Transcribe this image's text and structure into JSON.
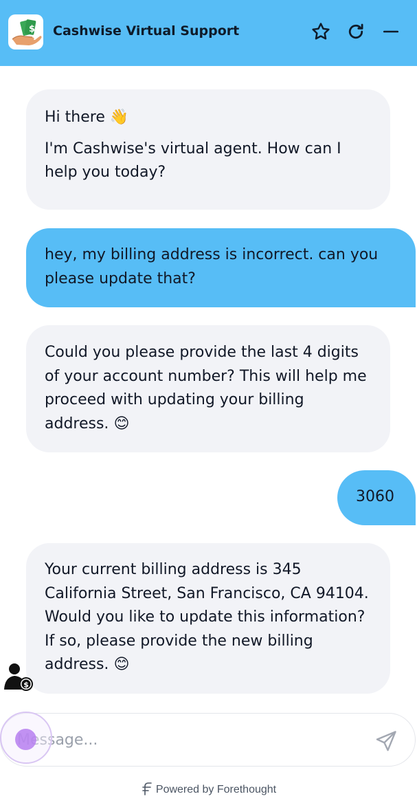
{
  "header": {
    "title": "Cashwise Virtual Support",
    "logo_icon": "money-hand-icon",
    "favorite_icon": "star-icon",
    "restart_icon": "refresh-icon",
    "minimize_icon": "minimize-icon",
    "background_color": "#57bdf6"
  },
  "messages": [
    {
      "sender": "bot",
      "paragraphs": [
        "Hi there",
        "I'm Cashwise's virtual agent. How can I help you today?"
      ],
      "emoji": "👋"
    },
    {
      "sender": "user",
      "text": "hey, my billing address is incorrect. can you please update that?"
    },
    {
      "sender": "bot",
      "text": "Could you please provide the last 4 digits of your account number? This will help me proceed with updating your billing address.",
      "emoji": "😊"
    },
    {
      "sender": "user",
      "text": "3060"
    },
    {
      "sender": "bot",
      "text": "Your current billing address is 345 California Street, San Francisco, CA 94104. Would you like to update this information? If so, please provide the new billing address.",
      "emoji": "😊"
    }
  ],
  "composer": {
    "placeholder": "Message...",
    "send_icon": "send-icon"
  },
  "footer": {
    "powered_by": "Powered by Forethought",
    "brand_icon": "forethought-logo-icon"
  },
  "colors": {
    "user_bubble": "#57bdf6",
    "bot_bubble": "#f2f3f7",
    "text": "#111827"
  }
}
